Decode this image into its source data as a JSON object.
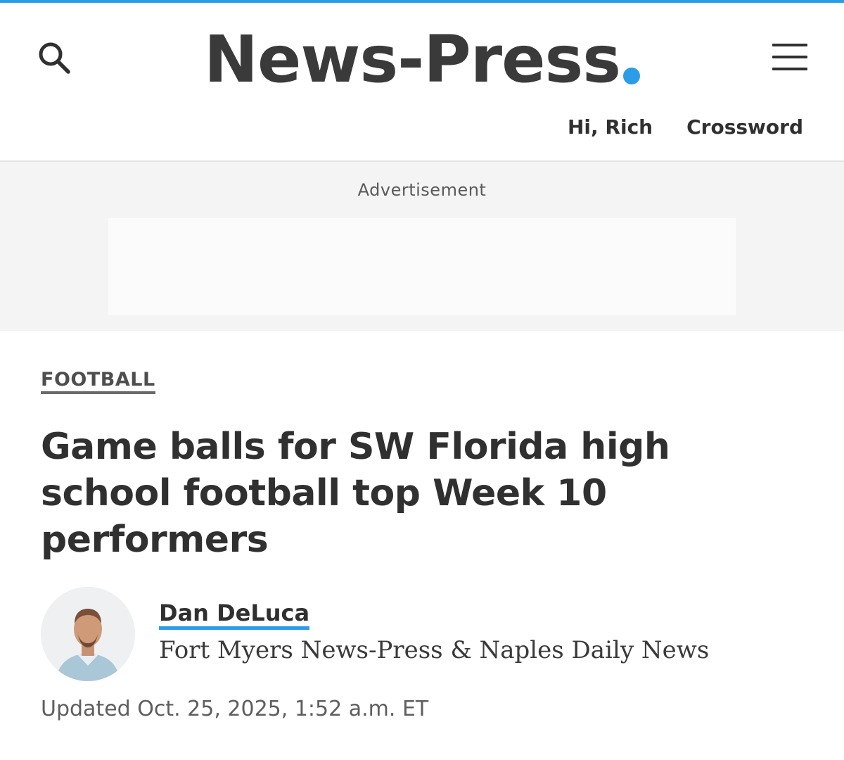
{
  "header": {
    "brand": "News-Press",
    "accent_color": "#2b9de8",
    "search_icon": "search-icon",
    "menu_icon": "hamburger-menu-icon",
    "greeting": "Hi, Rich",
    "crossword": "Crossword"
  },
  "ad": {
    "label": "Advertisement"
  },
  "article": {
    "section": "FOOTBALL",
    "headline": "Game balls for SW Florida high school football top Week 10 performers",
    "author": "Dan DeLuca",
    "affiliation": "Fort Myers News-Press & Naples Daily News",
    "updated": "Updated Oct. 25, 2025, 1:52 a.m. ET"
  }
}
